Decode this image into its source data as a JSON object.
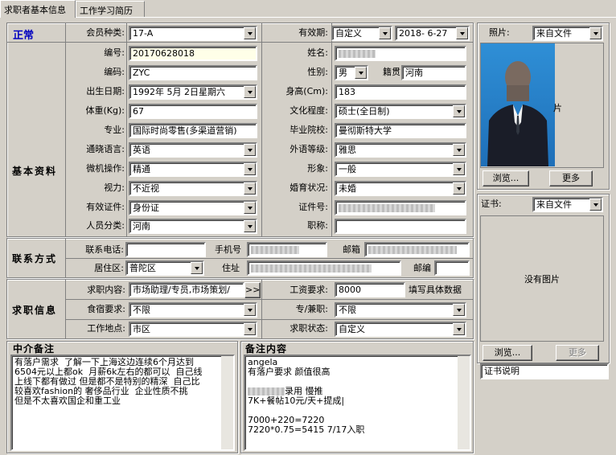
{
  "tabs": [
    "求职者基本信息",
    "工作学习简历"
  ],
  "status": "正常",
  "basic": {
    "member_type_label": "会员种类:",
    "member_type": "17-A",
    "validity_label": "有效期:",
    "validity_type": "自定义",
    "validity_date": "2018- 6-27",
    "id_label": "编号:",
    "id": "20170628018",
    "name_label": "姓名:",
    "name": "",
    "code_label": "编码:",
    "code": "ZYC",
    "gender_label": "性别:",
    "gender": "男",
    "hometown_label": "籍贯",
    "hometown": "河南",
    "birth_label": "出生日期:",
    "birth": "1992年 5月 2日星期六",
    "height_label": "身高(Cm):",
    "height": "183",
    "weight_label": "体重(Kg):",
    "weight": "67",
    "education_label": "文化程度:",
    "education": "硕士(全日制)",
    "major_label": "专业:",
    "major": "国际时尚零售(多渠道营销)",
    "school_label": "毕业院校:",
    "school": "曼彻斯特大学",
    "language_label": "通晓语言:",
    "language": "英语",
    "lang_level_label": "外语等级:",
    "lang_level": "雅思",
    "computer_label": "微机操作:",
    "computer": "精通",
    "image_label": "形象:",
    "image": "一般",
    "vision_label": "视力:",
    "vision": "不近视",
    "marital_label": "婚育状况:",
    "marital": "未婚",
    "idtype_label": "有效证件:",
    "idtype": "身份证",
    "idno_label": "证件号:",
    "idno": "",
    "category_label": "人员分类:",
    "category": "河南",
    "title_label": "职称:",
    "title": ""
  },
  "section_basic": "基本资料",
  "section_contact": "联系方式",
  "section_job": "求职信息",
  "contact": {
    "phone_label": "联系电话:",
    "phone": "",
    "mobile_label": "手机号",
    "mobile": "",
    "email_label": "邮箱",
    "email": "",
    "district_label": "居住区:",
    "district": "普陀区",
    "address_label": "住址",
    "address": "",
    "postcode_label": "邮编",
    "postcode": ""
  },
  "job": {
    "content_label": "求职内容:",
    "content": "市场助理/专员,市场策划/",
    "more_btn": ">>",
    "salary_label": "工资要求:",
    "salary": "8000",
    "salary_hint": "填写具体数据",
    "board_label": "食宿要求:",
    "board": "不限",
    "parttime_label": "专/兼职:",
    "parttime": "不限",
    "location_label": "工作地点:",
    "location": "市区",
    "state_label": "求职状态:",
    "state": "自定义"
  },
  "agent_note": {
    "title": "中介备注",
    "text": "有落户需求  了解一下上海这边连续6个月达到\n6504元以上都ok  月薪6k左右的都可以  自己线\n上线下都有做过 但是都不是特别的精深  自己比\n较喜欢fashion的 奢侈品行业  企业性质不挑\n但是不太喜欢国企和重工业"
  },
  "remark": {
    "title": "备注内容",
    "line1": "angela",
    "line2": "有落户要求 颜值很高",
    "line3": "录用 慢推",
    "line4": "7K+餐帖10元/天+提成|",
    "line5": "7000+220=7220",
    "line6": "7220*0.75=5415  7/17入职"
  },
  "photo": {
    "label": "照片:",
    "source": "来自文件",
    "browse": "浏览...",
    "more": "更多"
  },
  "cert": {
    "label": "证书:",
    "source": "来自文件",
    "no_image": "没有图片",
    "browse": "浏览...",
    "more": "更多",
    "desc": "证书说明"
  }
}
